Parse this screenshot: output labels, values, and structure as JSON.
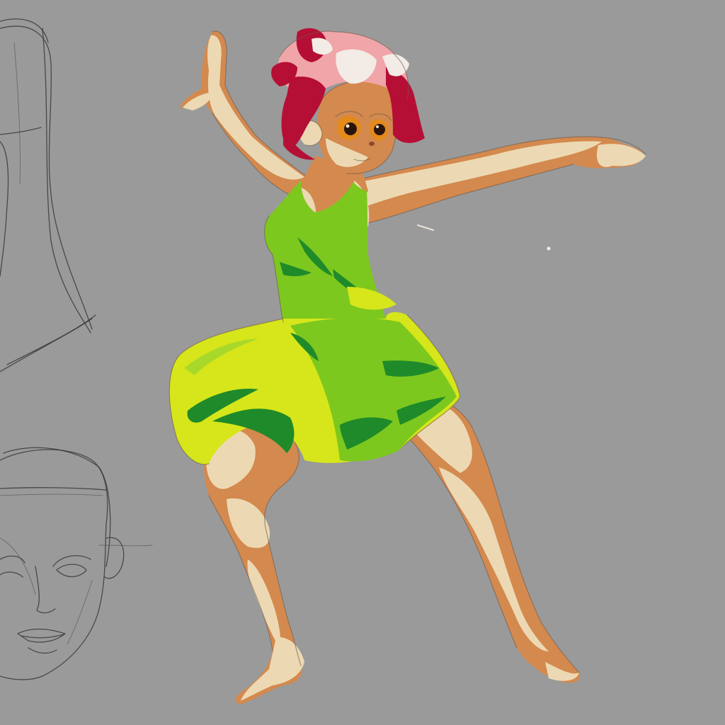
{
  "artwork": {
    "background_color": "#9a9a9a",
    "palette": {
      "skin_base": "#d4894e",
      "skin_light": "#ecd9b3",
      "skin_shadow": "#b8703c",
      "dress_light": "#d6e61a",
      "dress_mid": "#7dc81e",
      "dress_dark": "#1f8a2a",
      "hair_red": "#b50f35",
      "hair_pink": "#f0a5a8",
      "hair_white": "#f3ece6",
      "eye_orange": "#e38a1b",
      "sketch_line": "#3a3a3a"
    },
    "elements": [
      "dancing-character",
      "face-sketch",
      "head-outline-sketch"
    ]
  }
}
